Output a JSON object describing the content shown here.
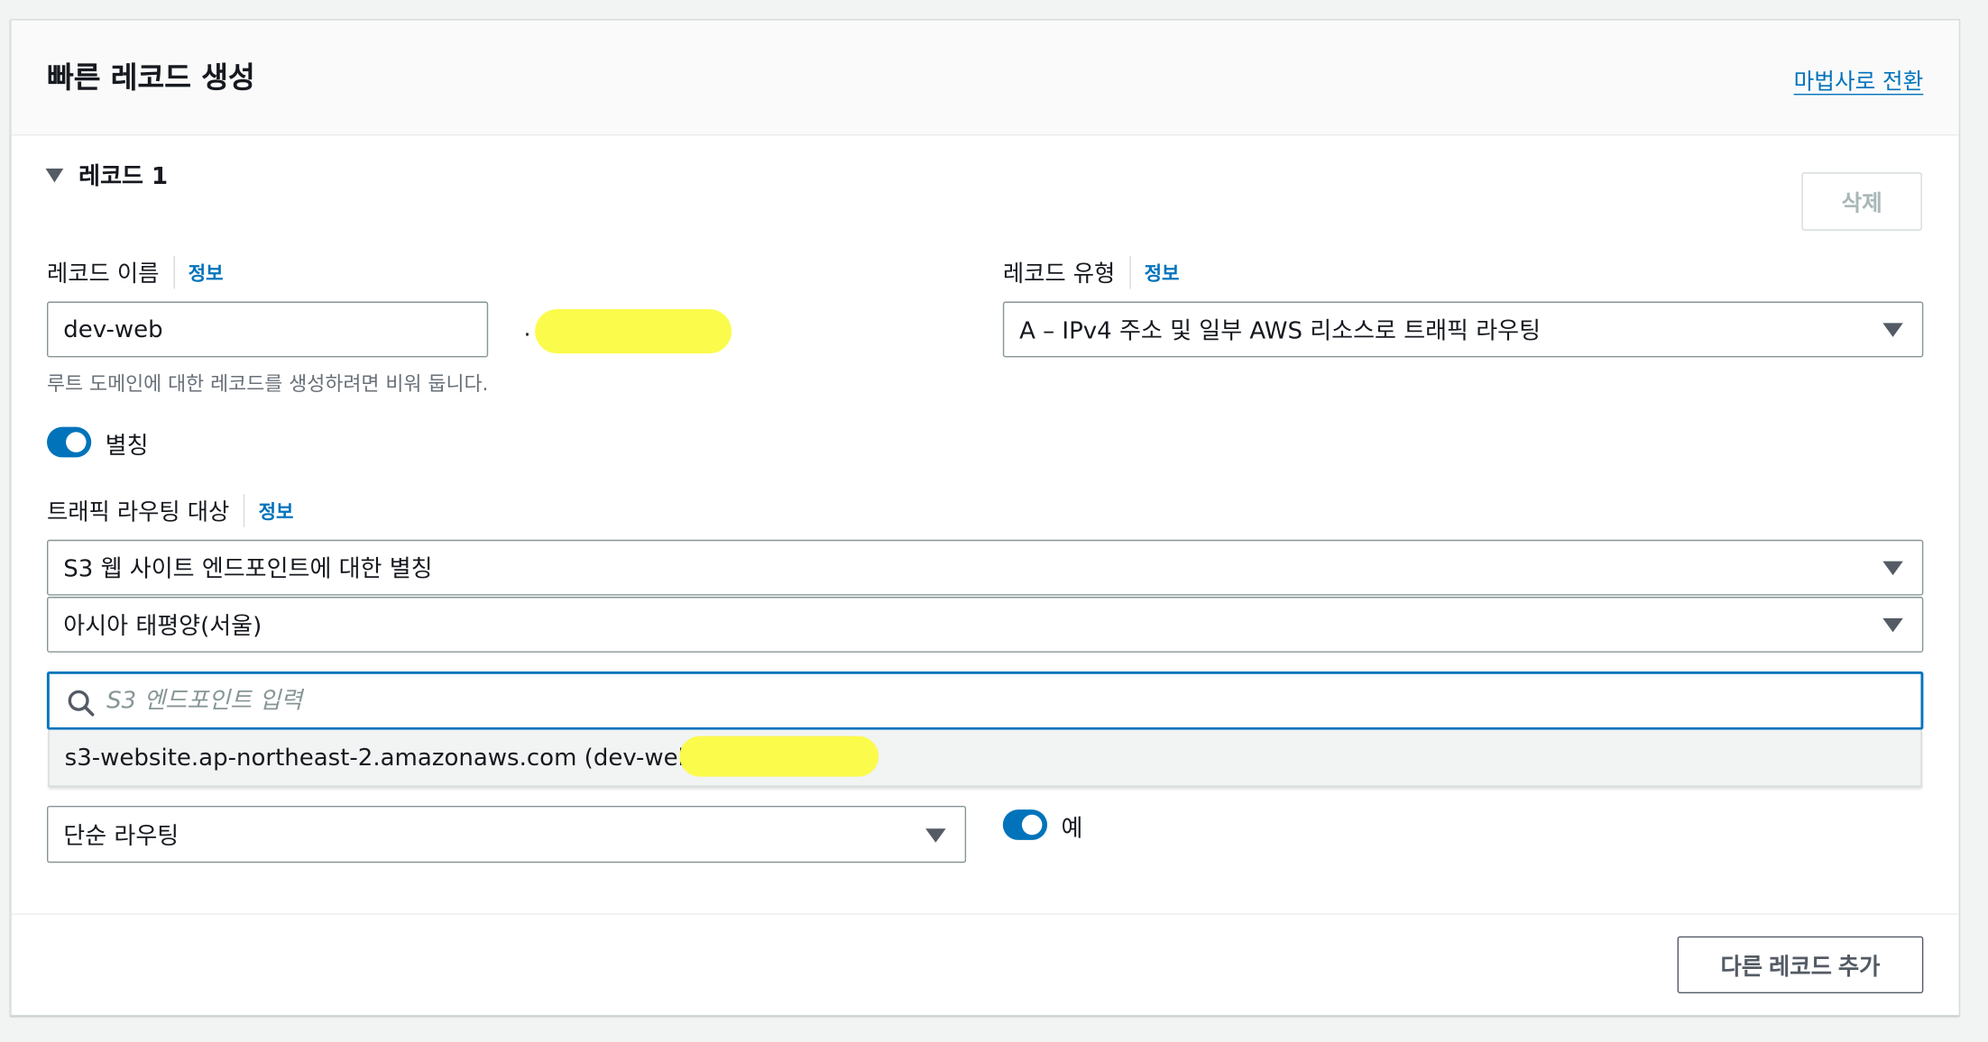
{
  "panel": {
    "title": "빠른 레코드 생성",
    "wizard_link": "마법사로 전환"
  },
  "record": {
    "heading": "레코드 1",
    "delete_label": "삭제",
    "name_label": "레코드 이름",
    "name_info": "정보",
    "name_value": "dev-web",
    "domain_suffix_prefix": ".",
    "name_hint": "루트 도메인에 대한 레코드를 생성하려면 비워 둡니다.",
    "type_label": "레코드 유형",
    "type_info": "정보",
    "type_value": "A – IPv4 주소 및 일부 AWS 리소스로 트래픽 라우팅",
    "alias_label": "별칭",
    "alias_enabled": true,
    "target_label": "트래픽 라우팅 대상",
    "target_info": "정보",
    "target_value": "S3 웹 사이트 엔드포인트에 대한 별칭",
    "region_value": "아시아 태평양(서울)",
    "endpoint_search_placeholder": "S3 엔드포인트 입력",
    "endpoint_search_value": "",
    "endpoint_option": "s3-website.ap-northeast-2.amazonaws.com (dev-web.",
    "routing_policy_value": "단순 라우팅",
    "evaluate_health_label": "예",
    "evaluate_health_enabled": true
  },
  "footer": {
    "add_record_label": "다른 레코드 추가"
  },
  "colors": {
    "accent": "#0073bb",
    "redaction": "#fbfb4c"
  }
}
